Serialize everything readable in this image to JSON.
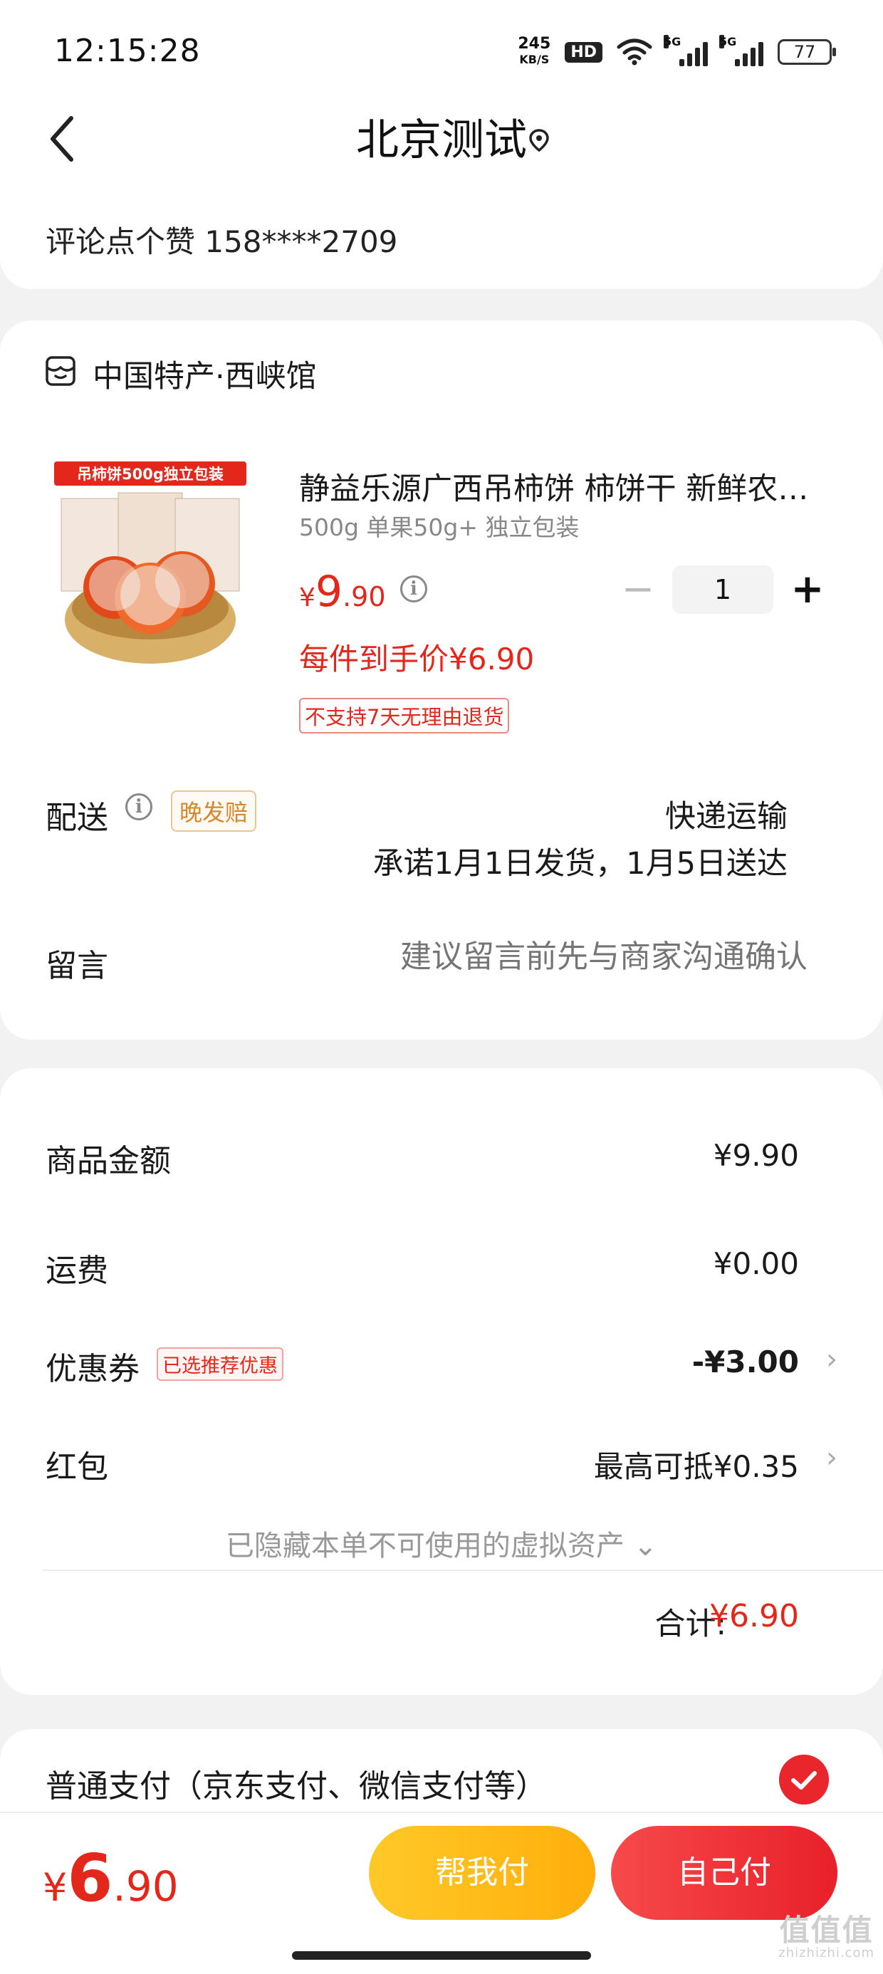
{
  "status": {
    "time": "12:15:28",
    "speed_value": "245",
    "speed_unit": "KB/S",
    "hd_badge": "HD",
    "network": "5G",
    "battery": "77"
  },
  "header": {
    "title": "北京测试",
    "address": "评论点个赞  158****2709"
  },
  "shop": {
    "name": "中国特产·西峡馆"
  },
  "product": {
    "image_banner": "吊柿饼500g独立包装",
    "title": "静益乐源广西吊柿饼 柿饼干 新鲜农…",
    "spec": "500g 单果50g+ 独立包装",
    "price_currency": "¥",
    "price_int": "9",
    "price_dec": ".90",
    "quantity": "1",
    "minus": "−",
    "plus": "+",
    "net_price": "每件到手价¥6.90",
    "no_return": "不支持7天无理由退货"
  },
  "delivery": {
    "label": "配送",
    "late_badge": "晚发赔",
    "mode": "快递运输",
    "promise": "承诺1月1日发货，1月5日送达"
  },
  "note": {
    "label": "留言",
    "placeholder": "建议留言前先与商家沟通确认"
  },
  "summary": {
    "goods_label": "商品金额",
    "goods_value": "¥9.90",
    "shipping_label": "运费",
    "shipping_value": "¥0.00",
    "coupon_label": "优惠券",
    "coupon_badge": "已选推荐优惠",
    "coupon_value": "-¥3.00",
    "redpacket_label": "红包",
    "redpacket_value": "最高可抵¥0.35",
    "hidden_assets": "已隐藏本单不可使用的虚拟资产 ⌄",
    "total_label": "合计:",
    "total_value": "¥6.90"
  },
  "payment": {
    "method": "普通支付（京东支付、微信支付等）"
  },
  "bottom": {
    "currency": "¥",
    "price_int": "6",
    "price_dec": ".90",
    "help_pay": "帮我付",
    "self_pay": "自己付"
  },
  "watermark": {
    "main": "值值值",
    "sub": "zhizhizhi.com"
  },
  "colors": {
    "accent_red": "#e3271b",
    "help_yellow": "#ffb812",
    "self_red": "#ee2c32"
  }
}
